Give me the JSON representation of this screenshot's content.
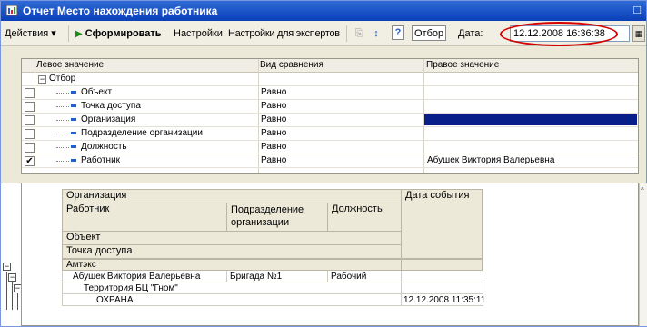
{
  "window": {
    "title": "Отчет  Место нахождения работника",
    "controls": [
      "_",
      "□",
      "×"
    ]
  },
  "toolbar": {
    "actions": "Действия",
    "generate": "Сформировать",
    "settings": "Настройки",
    "expert_settings": "Настройки для экспертов",
    "help": "?",
    "filter": "Отбор",
    "date_label": "Дата:",
    "date_value": "12.12.2008 16:36:38"
  },
  "filter_table": {
    "columns": [
      "Левое значение",
      "Вид сравнения",
      "Правое значение"
    ],
    "group": "Отбор",
    "rows": [
      {
        "left": "Объект",
        "comparison": "Равно",
        "right": "",
        "checked": false
      },
      {
        "left": "Точка доступа",
        "comparison": "Равно",
        "right": "",
        "checked": false
      },
      {
        "left": "Организация",
        "comparison": "Равно",
        "right": "",
        "checked": false,
        "selected": true
      },
      {
        "left": "Подразделение организации",
        "comparison": "Равно",
        "right": "",
        "checked": false
      },
      {
        "left": "Должность",
        "comparison": "Равно",
        "right": "",
        "checked": false
      },
      {
        "left": "Работник",
        "comparison": "Равно",
        "right": "Абушек Виктория Валерьевна",
        "checked": true
      }
    ]
  },
  "report": {
    "headers": {
      "organization": "Организация",
      "employee": "Работник",
      "department": "Подразделение организации",
      "position": "Должность",
      "object": "Объект",
      "access_point": "Точка доступа",
      "event_date": "Дата события"
    },
    "rows": {
      "organization": "Амтэкс",
      "employee": "Абушек Виктория Валерьевна",
      "department": "Бригада №1",
      "position": "Рабочий",
      "object": "Территория БЦ \"Гном\"",
      "access_point": "ОХРАНА",
      "event_date": "12.12.2008 11:35:11"
    }
  },
  "accent_colors": {
    "title_bar": "#0a3fb8",
    "highlight": "#0a1e8a",
    "annotation_oval": "#d40000"
  }
}
